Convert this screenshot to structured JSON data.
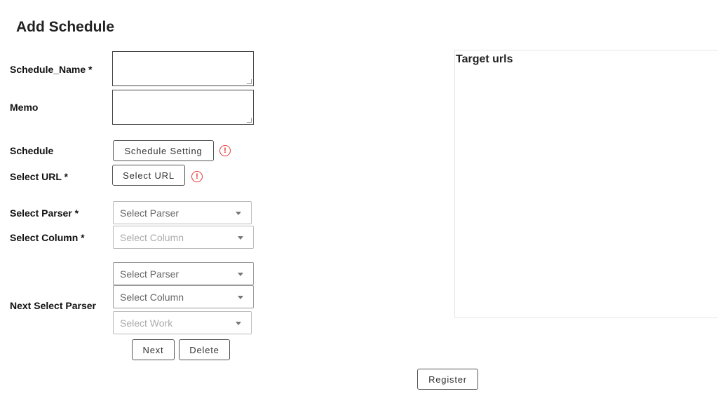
{
  "page": {
    "title": "Add Schedule"
  },
  "form": {
    "schedule_name_label": "Schedule_Name *",
    "schedule_name_value": "",
    "memo_label": "Memo",
    "memo_value": "",
    "schedule_label": "Schedule",
    "schedule_setting_button": "Schedule Setting",
    "select_url_label": "Select URL *",
    "select_url_button": "Select URL",
    "select_parser_label": "Select Parser *",
    "select_parser_placeholder": "Select Parser",
    "select_column_label": "Select Column *",
    "select_column_placeholder": "Select Column",
    "next_select_parser_label": "Next Select Parser",
    "next_parser_placeholder": "Select Parser",
    "next_column_placeholder": "Select Column",
    "next_work_placeholder": "Select Work",
    "next_button": "Next",
    "delete_button": "Delete",
    "register_button": "Register",
    "alert_glyph": "!"
  },
  "target_panel": {
    "title": "Target urls"
  },
  "colors": {
    "alert": "#e53935",
    "text": "#111111",
    "border": "#444444",
    "placeholder": "#aaaaaa"
  }
}
